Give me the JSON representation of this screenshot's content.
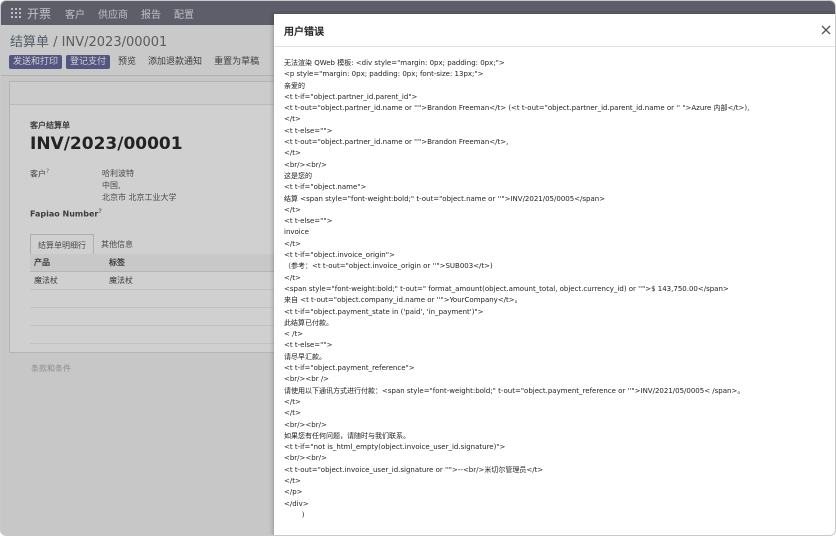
{
  "nav": {
    "app_name": "开票",
    "items": [
      "客户",
      "供应商",
      "报告",
      "配置"
    ]
  },
  "breadcrumb": {
    "parent": "结算单",
    "separator": " / ",
    "current": "INV/2023/00001"
  },
  "buttons": {
    "send_print": "发送和打印",
    "register_payment": "登记支付",
    "preview": "预览",
    "add_credit_note": "添加退款通知",
    "reset_draft": "重置为草稿"
  },
  "form": {
    "doc_type": "客户结算单",
    "number": "INV/2023/00001",
    "customer_label": "客户",
    "customer_help": "?",
    "customer_name": "哈利波特",
    "address_line1": "中国,",
    "address_line2": "北京市 北京工业大学",
    "fapiao_label": "Fapiao Number",
    "fapiao_help": "?",
    "tabs": [
      "结算单明细行",
      "其他信息"
    ],
    "columns": [
      "产品",
      "标签"
    ],
    "rows": [
      [
        "魔法杖",
        "魔法杖"
      ]
    ],
    "terms_placeholder": "条款和条件"
  },
  "modal": {
    "title": "用户错误",
    "lines": [
      "无法渲染 QWeb 模板: <div style=\"margin: 0px; padding: 0px;\">",
      "<p style=\"margin: 0px; padding: 0px; font-size: 13px;\">",
      "亲爱的",
      "<t t-if=\"object.partner_id.parent_id\">",
      "<t t-out=\"object.partner_id.name or ''\">Brandon Freeman</t> (<t t-out=\"object.partner_id.parent_id.name or '' \">Azure 内部</t>),",
      "</t>",
      "<t t-else=\"\">",
      "<t t-out=\"object.partner_id.name or ''\">Brandon Freeman</t>,",
      "</t>",
      "<br/><br/>",
      "这是您的",
      "<t t-if=\"object.name\">",
      "结算 <span style=\"font-weight:bold;\" t-out=\"object.name or ''\">INV/2021/05/0005</span>",
      "</t>",
      "<t t-else=\"\">",
      "invoice",
      "</t>",
      "<t t-if=\"object.invoice_origin\">",
      "（参考：<t t-out=\"object.invoice_origin or ''\">SUB003</t>)",
      "</t>",
      "<span style=\"font-weight:bold;\" t-out=\" format_amount(object.amount_total, object.currency_id) or ''\">$ 143,750.00</span>",
      "来自 <t t-out=\"object.company_id.name or ''\">YourCompany</t>。",
      "<t t-if=\"object.payment_state in ('paid', 'in_payment')\">",
      "此结算已付款。",
      "< /t>",
      "<t t-else=\"\">",
      "请尽早汇款。",
      "<t t-if=\"object.payment_reference\">",
      "<br/><br />",
      "请使用以下通讯方式进行付款：<span style=\"font-weight:bold;\" t-out=\"object.payment_reference or ''\">INV/2021/05/0005< /span>。",
      "</t>",
      "</t>",
      "<br/><br/>",
      "如果您有任何问题，请随时与我们联系。",
      "<t t-if=\"not is_html_empty(object.invoice_user_id.signature)\">",
      "<br/><br/>",
      "<t t-out=\"object.invoice_user_id.signature or ''\">--<br/>米切尔管理员</t>",
      "</t>",
      "</p>",
      "</div>",
      "        )"
    ]
  },
  "icons": {
    "apps": "apps-grid-icon",
    "close": "close-icon"
  },
  "colors": {
    "nav": "#6d6d7d",
    "primary_button": "#62629a"
  }
}
